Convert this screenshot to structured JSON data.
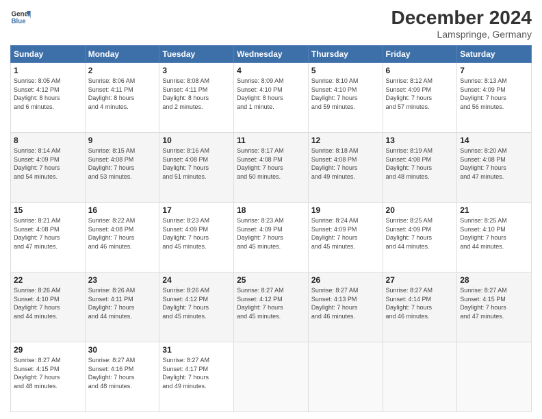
{
  "header": {
    "logo_line1": "General",
    "logo_line2": "Blue",
    "title": "December 2024",
    "subtitle": "Lamspringe, Germany"
  },
  "columns": [
    "Sunday",
    "Monday",
    "Tuesday",
    "Wednesday",
    "Thursday",
    "Friday",
    "Saturday"
  ],
  "weeks": [
    [
      {
        "day": "1",
        "sr": "8:05 AM",
        "ss": "4:12 PM",
        "dl": "8 hours and 6 minutes."
      },
      {
        "day": "2",
        "sr": "8:06 AM",
        "ss": "4:11 PM",
        "dl": "8 hours and 4 minutes."
      },
      {
        "day": "3",
        "sr": "8:08 AM",
        "ss": "4:11 PM",
        "dl": "8 hours and 2 minutes."
      },
      {
        "day": "4",
        "sr": "8:09 AM",
        "ss": "4:10 PM",
        "dl": "8 hours and 1 minute."
      },
      {
        "day": "5",
        "sr": "8:10 AM",
        "ss": "4:10 PM",
        "dl": "7 hours and 59 minutes."
      },
      {
        "day": "6",
        "sr": "8:12 AM",
        "ss": "4:09 PM",
        "dl": "7 hours and 57 minutes."
      },
      {
        "day": "7",
        "sr": "8:13 AM",
        "ss": "4:09 PM",
        "dl": "7 hours and 56 minutes."
      }
    ],
    [
      {
        "day": "8",
        "sr": "8:14 AM",
        "ss": "4:09 PM",
        "dl": "7 hours and 54 minutes."
      },
      {
        "day": "9",
        "sr": "8:15 AM",
        "ss": "4:08 PM",
        "dl": "7 hours and 53 minutes."
      },
      {
        "day": "10",
        "sr": "8:16 AM",
        "ss": "4:08 PM",
        "dl": "7 hours and 51 minutes."
      },
      {
        "day": "11",
        "sr": "8:17 AM",
        "ss": "4:08 PM",
        "dl": "7 hours and 50 minutes."
      },
      {
        "day": "12",
        "sr": "8:18 AM",
        "ss": "4:08 PM",
        "dl": "7 hours and 49 minutes."
      },
      {
        "day": "13",
        "sr": "8:19 AM",
        "ss": "4:08 PM",
        "dl": "7 hours and 48 minutes."
      },
      {
        "day": "14",
        "sr": "8:20 AM",
        "ss": "4:08 PM",
        "dl": "7 hours and 47 minutes."
      }
    ],
    [
      {
        "day": "15",
        "sr": "8:21 AM",
        "ss": "4:08 PM",
        "dl": "7 hours and 47 minutes."
      },
      {
        "day": "16",
        "sr": "8:22 AM",
        "ss": "4:08 PM",
        "dl": "7 hours and 46 minutes."
      },
      {
        "day": "17",
        "sr": "8:23 AM",
        "ss": "4:09 PM",
        "dl": "7 hours and 45 minutes."
      },
      {
        "day": "18",
        "sr": "8:23 AM",
        "ss": "4:09 PM",
        "dl": "7 hours and 45 minutes."
      },
      {
        "day": "19",
        "sr": "8:24 AM",
        "ss": "4:09 PM",
        "dl": "7 hours and 45 minutes."
      },
      {
        "day": "20",
        "sr": "8:25 AM",
        "ss": "4:09 PM",
        "dl": "7 hours and 44 minutes."
      },
      {
        "day": "21",
        "sr": "8:25 AM",
        "ss": "4:10 PM",
        "dl": "7 hours and 44 minutes."
      }
    ],
    [
      {
        "day": "22",
        "sr": "8:26 AM",
        "ss": "4:10 PM",
        "dl": "7 hours and 44 minutes."
      },
      {
        "day": "23",
        "sr": "8:26 AM",
        "ss": "4:11 PM",
        "dl": "7 hours and 44 minutes."
      },
      {
        "day": "24",
        "sr": "8:26 AM",
        "ss": "4:12 PM",
        "dl": "7 hours and 45 minutes."
      },
      {
        "day": "25",
        "sr": "8:27 AM",
        "ss": "4:12 PM",
        "dl": "7 hours and 45 minutes."
      },
      {
        "day": "26",
        "sr": "8:27 AM",
        "ss": "4:13 PM",
        "dl": "7 hours and 46 minutes."
      },
      {
        "day": "27",
        "sr": "8:27 AM",
        "ss": "4:14 PM",
        "dl": "7 hours and 46 minutes."
      },
      {
        "day": "28",
        "sr": "8:27 AM",
        "ss": "4:15 PM",
        "dl": "7 hours and 47 minutes."
      }
    ],
    [
      {
        "day": "29",
        "sr": "8:27 AM",
        "ss": "4:15 PM",
        "dl": "7 hours and 48 minutes."
      },
      {
        "day": "30",
        "sr": "8:27 AM",
        "ss": "4:16 PM",
        "dl": "7 hours and 48 minutes."
      },
      {
        "day": "31",
        "sr": "8:27 AM",
        "ss": "4:17 PM",
        "dl": "7 hours and 49 minutes."
      },
      null,
      null,
      null,
      null
    ]
  ]
}
